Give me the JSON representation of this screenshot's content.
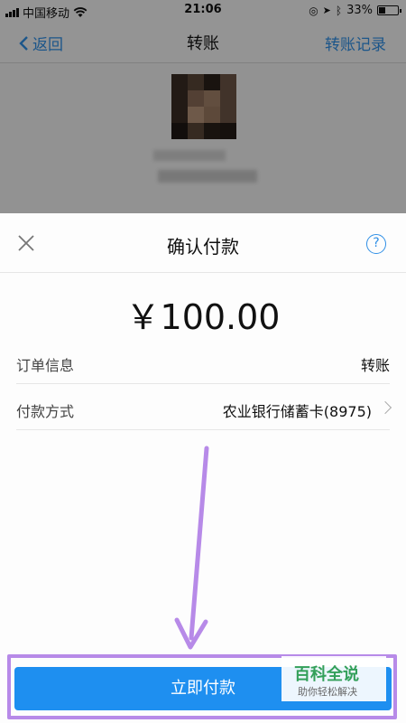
{
  "status_bar": {
    "carrier": "中国移动",
    "time": "21:06",
    "battery_level": 0.33,
    "battery_text": "33%"
  },
  "nav": {
    "back_label": "返回",
    "title": "转账",
    "right_label": "转账记录"
  },
  "sheet": {
    "title": "确认付款",
    "help_icon_text": "?",
    "amount": "￥100.00",
    "order_info_label": "订单信息",
    "order_info_value": "转账",
    "payment_method_label": "付款方式",
    "payment_method_value": "农业银行储蓄卡(8975)",
    "pay_button_label": "立即付款"
  },
  "watermark": {
    "title": "百科全说",
    "subtitle": "助你轻松解决"
  },
  "icons": [
    "close-icon",
    "help-icon",
    "chevron-right-icon",
    "back-chevron-icon",
    "wifi-icon",
    "signal-icon",
    "battery-icon"
  ],
  "colors": {
    "accent": "#2f8fe6",
    "pay_button": "#1e8ff0",
    "annotation": "#b78ae8",
    "watermark_green": "#33a05a"
  }
}
